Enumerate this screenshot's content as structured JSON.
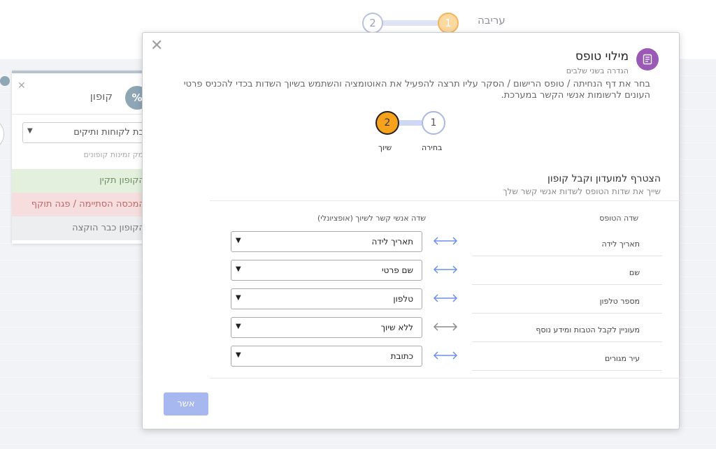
{
  "background": {
    "stepper": {
      "step1": "1",
      "step2": "2",
      "label": "עריבה"
    },
    "coupon_card": {
      "title": "קופון",
      "avatar_symbol": "%",
      "select_value": "הטבת לקוחות ותיקים",
      "hint": "מק זמינות קופונים",
      "status_valid": "הקופון תקין",
      "status_expired": "המכסה הסתיימה / פגה תוקף",
      "status_used": "הקופון כבר הוקצה"
    }
  },
  "modal": {
    "title": "מילוי טופס",
    "subtitle": "הגדרה בשני שלבים",
    "description": "בחר את דף הנחיתה / טופס הרישום / הסקר עליו תרצה להפעיל את האוטומציה והשתמש בשיוך השדות בכדי להכניס פרטי העונים לרשומות אנשי הקשר במערכת.",
    "stepper": {
      "step1_number": "1",
      "step1_label": "בחירה",
      "step2_number": "2",
      "step2_label": "שיוך"
    },
    "section_title": "הצטרף למועדון וקבל קופון",
    "section_subtitle": "שייך את שדות הטופס לשדות אנשי קשר שלך",
    "column_form_field": "שדה הטופס",
    "column_contact_field": "שדה אנשי קשר לשיוך (אופציונלי)",
    "rows": [
      {
        "form_field": "תאריך לידה",
        "contact_field": "תאריך לידה",
        "mapped": true
      },
      {
        "form_field": "שם",
        "contact_field": "שם פרטי",
        "mapped": true
      },
      {
        "form_field": "מספר טלפון",
        "contact_field": "טלפון",
        "mapped": true
      },
      {
        "form_field": "מעוניין לקבל הטבות ומידע נוסף",
        "contact_field": "ללא שיוך",
        "mapped": false
      },
      {
        "form_field": "עיר מגורים",
        "contact_field": "כתובת",
        "mapped": true
      }
    ],
    "confirm_label": "אשר",
    "colors": {
      "mapped_arrow": "#6f8fe8",
      "unmapped_arrow": "#8a8a8a",
      "accent": "#f7a21c",
      "form_icon": "#9b59b6",
      "confirm": "#a7b8f0"
    }
  }
}
